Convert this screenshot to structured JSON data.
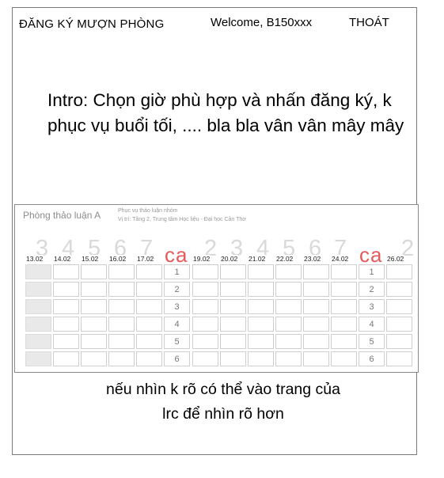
{
  "header": {
    "app_title": "ĐĂNG KÝ MƯỢN PHÒNG",
    "welcome": "Welcome, B150xxx",
    "logout_label": "THOÁT"
  },
  "intro": {
    "text": "Intro: Chọn giờ phù hợp và nhấn đăng ký, k phục vụ buổi tối, .... bla bla vân vân mây mây"
  },
  "schedule": {
    "room_name": "Phòng thảo luận A",
    "room_desc_line1": "Phục vụ thảo luận nhóm",
    "room_desc_line2": "Vị trí: Tầng 2, Trung tâm Học liệu - Đại học Cần Thơ",
    "slot_label": "ca",
    "weekday_numbers_week1": [
      "3",
      "4",
      "5",
      "6",
      "7"
    ],
    "weekday_numbers_week2": [
      "2",
      "3",
      "4",
      "5",
      "6",
      "7"
    ],
    "week1_dates": [
      "13.02",
      "14.02",
      "15.02",
      "16.02",
      "17.02"
    ],
    "week2_dates": [
      "19.02",
      "20.02",
      "21.02",
      "22.02",
      "23.02",
      "24.02"
    ],
    "last_date": "26.02",
    "trailing_digit": "2",
    "slots": [
      "1",
      "2",
      "3",
      "4",
      "5",
      "6"
    ]
  },
  "footer": {
    "line1": "nếu nhìn k rõ có thể vào trang của",
    "line2": "lrc để nhìn rõ hơn"
  }
}
